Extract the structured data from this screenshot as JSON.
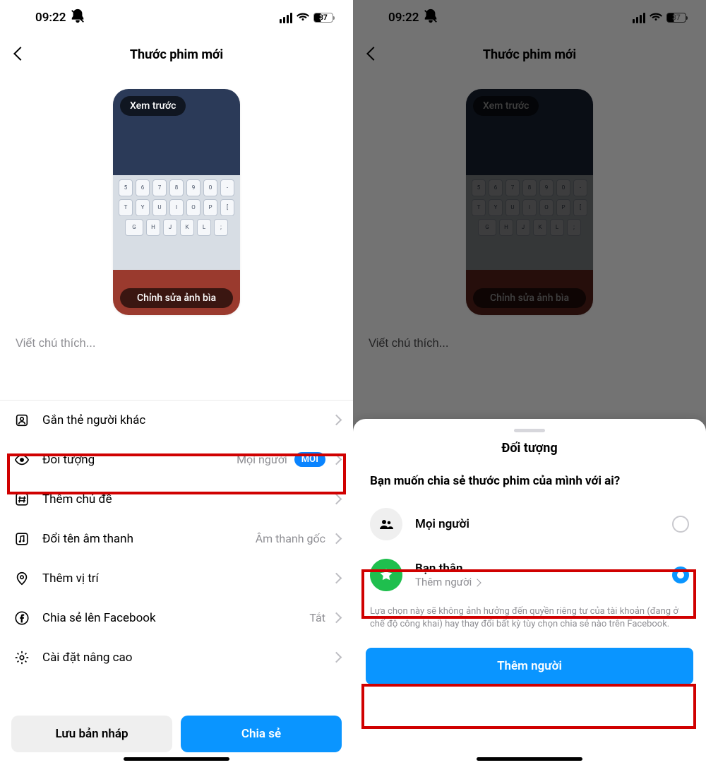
{
  "status": {
    "time": "09:22",
    "battery": "37"
  },
  "header": {
    "title": "Thước phim mới"
  },
  "preview": {
    "preview_label": "Xem trước",
    "edit_cover_label": "Chỉnh sửa ảnh bìa",
    "keys_row1": [
      "5",
      "6",
      "7",
      "8",
      "9",
      "0",
      "-"
    ],
    "keys_row2": [
      "T",
      "Y",
      "U",
      "I",
      "O",
      "P",
      "["
    ],
    "keys_row3": [
      "G",
      "H",
      "J",
      "K",
      "L",
      ";"
    ]
  },
  "caption": {
    "placeholder": "Viết chú thích..."
  },
  "rows": {
    "tag": "Gắn thẻ người khác",
    "audience": "Đối tượng",
    "audience_value": "Mọi người",
    "audience_badge": "MỚI",
    "topic": "Thêm chủ đề",
    "rename_audio": "Đổi tên âm thanh",
    "audio_value": "Âm thanh gốc",
    "location": "Thêm vị trí",
    "share_fb": "Chia sẻ lên Facebook",
    "share_fb_value": "Tắt",
    "advanced": "Cài đặt nâng cao"
  },
  "actions": {
    "draft": "Lưu bản nháp",
    "share": "Chia sẻ"
  },
  "sheet": {
    "title": "Đối tượng",
    "question": "Bạn muốn chia sẻ thước phim của mình với ai?",
    "opt1": "Mọi người",
    "opt2_title": "Bạn thân",
    "opt2_sub": "Thêm người",
    "note": "Lựa chọn này sẽ không ảnh hưởng đến quyền riêng tư của tài khoản (đang ở chế độ công khai) hay thay đổi bất kỳ tùy chọn chia sẻ nào trên Facebook.",
    "button": "Thêm người"
  }
}
